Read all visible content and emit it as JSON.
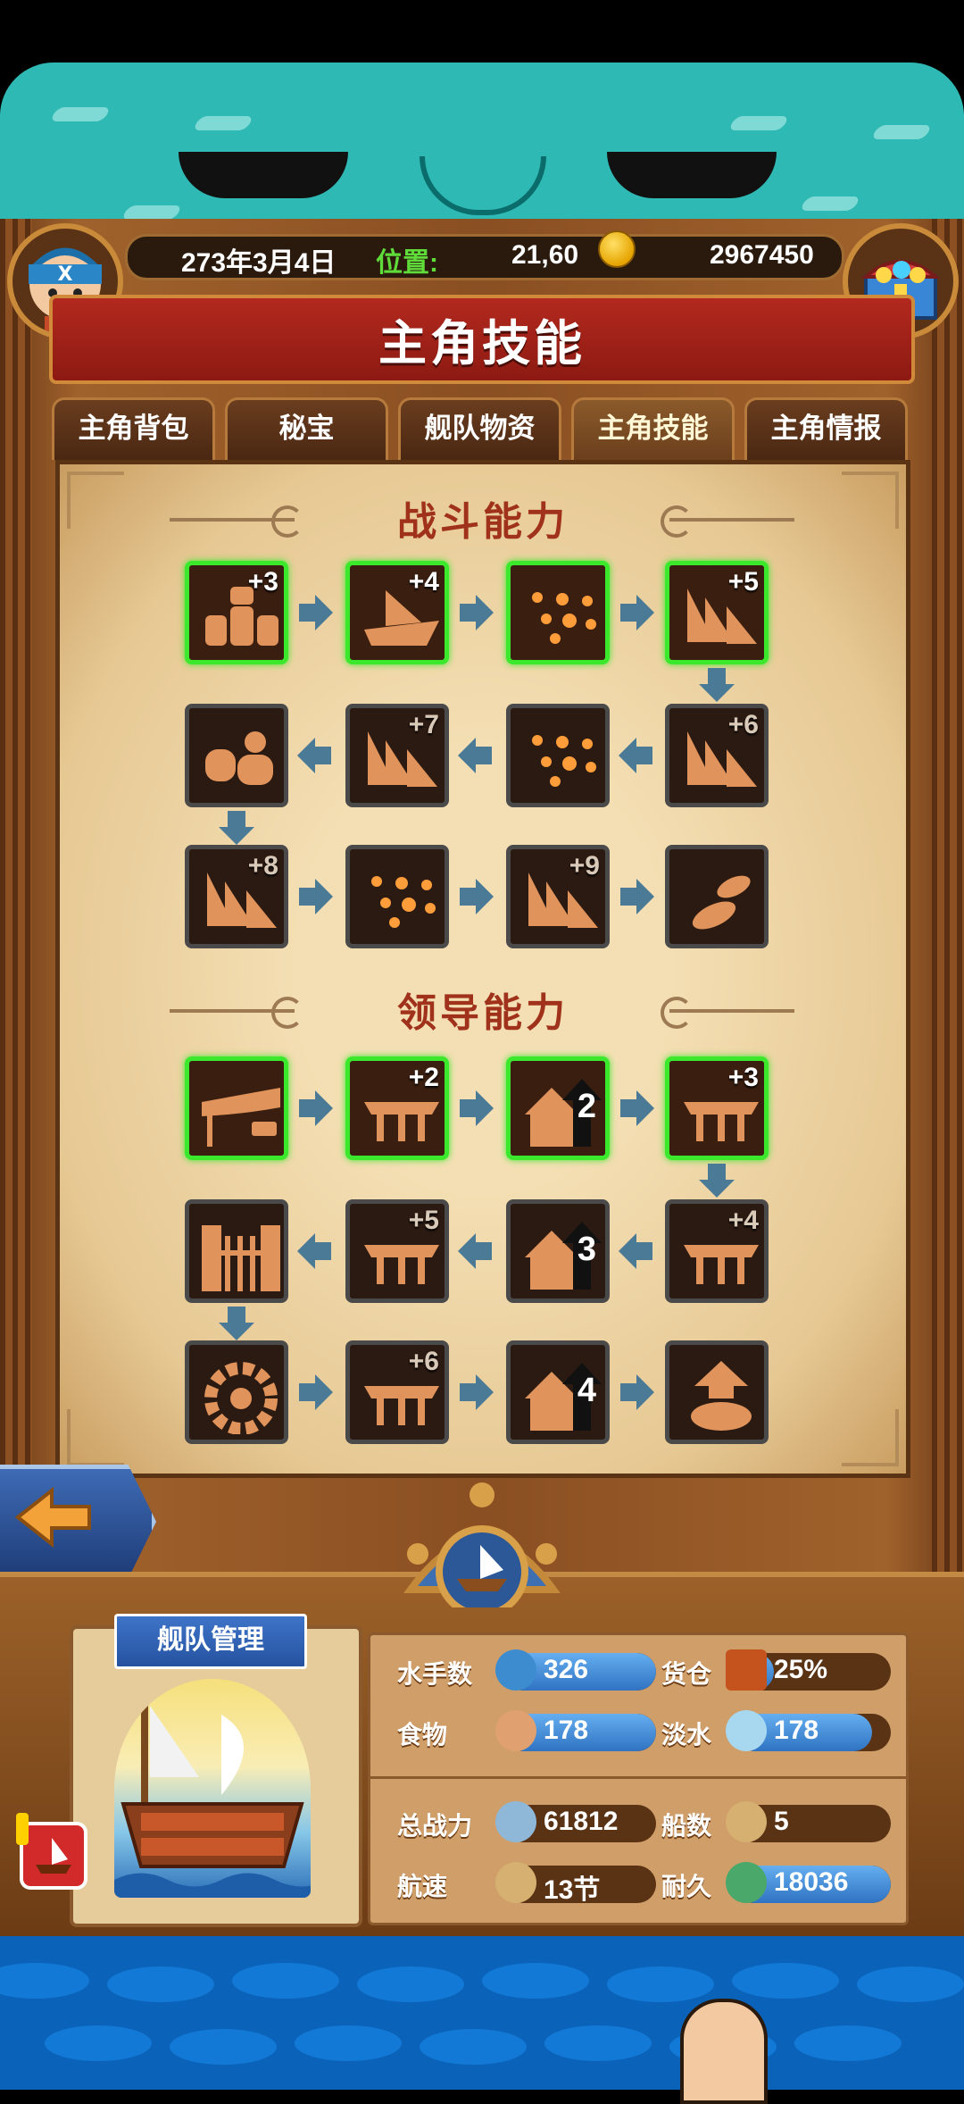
{
  "header": {
    "date": "273年3月4日",
    "position_label": "位置:",
    "position_value": "21,60",
    "gold": "2967450"
  },
  "title": "主角技能",
  "tabs": [
    {
      "label": "主角背包",
      "active": false
    },
    {
      "label": "秘宝",
      "active": false
    },
    {
      "label": "舰队物资",
      "active": false
    },
    {
      "label": "主角技能",
      "active": true
    },
    {
      "label": "主角情报",
      "active": false
    }
  ],
  "sections": {
    "combat": {
      "title": "战斗能力",
      "skills": [
        {
          "icon": "barrels-icon",
          "level": "+3",
          "unlocked": true
        },
        {
          "icon": "ship-icon",
          "level": "+4",
          "unlocked": true
        },
        {
          "icon": "formation-icon",
          "level": "",
          "unlocked": true
        },
        {
          "icon": "fleet-icon",
          "level": "+5",
          "unlocked": true
        },
        {
          "icon": "fleet-icon",
          "level": "+6",
          "unlocked": false
        },
        {
          "icon": "formation-icon",
          "level": "",
          "unlocked": false
        },
        {
          "icon": "fleet-icon",
          "level": "+7",
          "unlocked": false
        },
        {
          "icon": "cannon-icon",
          "level": "",
          "unlocked": false
        },
        {
          "icon": "fleet-icon",
          "level": "+8",
          "unlocked": false
        },
        {
          "icon": "formation-icon",
          "level": "",
          "unlocked": false
        },
        {
          "icon": "fleet-icon",
          "level": "+9",
          "unlocked": false
        },
        {
          "icon": "cannonball-icon",
          "level": "",
          "unlocked": false
        }
      ]
    },
    "leadership": {
      "title": "领导能力",
      "skills": [
        {
          "icon": "tent-icon",
          "level": "",
          "unlocked": true
        },
        {
          "icon": "dock-icon",
          "level": "+2",
          "unlocked": true
        },
        {
          "icon": "house-upgrade-icon",
          "level": "2",
          "unlocked": true
        },
        {
          "icon": "dock-icon",
          "level": "+3",
          "unlocked": true
        },
        {
          "icon": "dock-icon",
          "level": "+4",
          "unlocked": false
        },
        {
          "icon": "house-upgrade-icon",
          "level": "3",
          "unlocked": false
        },
        {
          "icon": "dock-icon",
          "level": "+5",
          "unlocked": false
        },
        {
          "icon": "fence-icon",
          "level": "",
          "unlocked": false
        },
        {
          "icon": "wheel-icon",
          "level": "",
          "unlocked": false
        },
        {
          "icon": "dock-icon",
          "level": "+6",
          "unlocked": false
        },
        {
          "icon": "house-upgrade-icon",
          "level": "4",
          "unlocked": false
        },
        {
          "icon": "coin-upgrade-icon",
          "level": "",
          "unlocked": false
        }
      ]
    }
  },
  "fleet": {
    "banner": "舰队管理",
    "stats": {
      "sailors_label": "水手数",
      "sailors": "326",
      "cargo_label": "货仓",
      "cargo": "25%",
      "food_label": "食物",
      "food": "178",
      "water_label": "淡水",
      "water": "178",
      "power_label": "总战力",
      "power": "61812",
      "ships_label": "船数",
      "ships": "5",
      "speed_label": "航速",
      "speed": "13节",
      "durability_label": "耐久",
      "durability": "18036"
    }
  }
}
